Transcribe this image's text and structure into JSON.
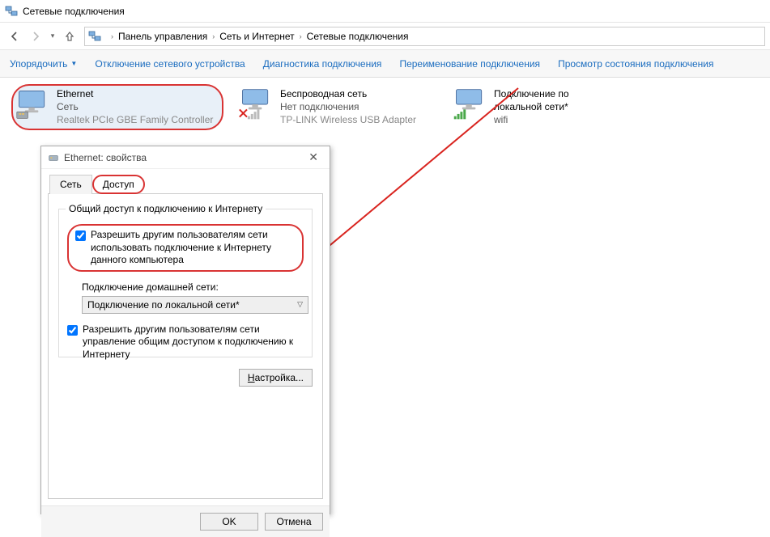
{
  "window": {
    "title": "Сетевые подключения"
  },
  "breadcrumb": {
    "root": "Панель управления",
    "mid": "Сеть и Интернет",
    "leaf": "Сетевые подключения"
  },
  "toolbar": {
    "organize": "Упорядочить",
    "disable": "Отключение сетевого устройства",
    "diagnose": "Диагностика подключения",
    "rename": "Переименование подключения",
    "status": "Просмотр состояния подключения"
  },
  "connections": [
    {
      "name": "Ethernet",
      "status": "Сеть",
      "device": "Realtek PCIe GBE Family Controller",
      "selected": true,
      "kind": "wired"
    },
    {
      "name": "Беспроводная сеть",
      "status": "Нет подключения",
      "device": "TP-LINK Wireless USB Adapter",
      "selected": false,
      "kind": "wifi-disabled"
    },
    {
      "name": "Подключение по локальной сети*",
      "status": "wifi",
      "device": "",
      "selected": false,
      "kind": "wifi"
    }
  ],
  "dialog": {
    "title": "Ethernet: свойства",
    "tabs": {
      "net": "Сеть",
      "access": "Доступ"
    },
    "group_title": "Общий доступ к подключению к Интернету",
    "chk_allow": "Разрешить другим пользователям сети использовать подключение к Интернету данного компьютера",
    "home_label": "Подключение домашней сети:",
    "home_value": "Подключение по локальной сети*",
    "chk_control": "Разрешить другим пользователям сети управление общим доступом к подключению к Интернету",
    "settings_btn_pre": "Н",
    "settings_btn_rest": "астройка...",
    "ok": "OK",
    "cancel": "Отмена"
  }
}
